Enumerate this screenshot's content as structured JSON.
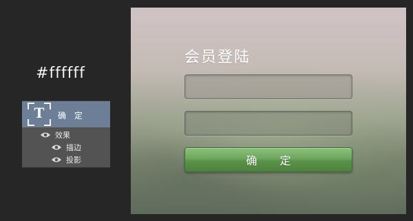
{
  "color_caption": "#ffffff",
  "layers_panel": {
    "text_layer": {
      "thumb_glyph": "T",
      "name": "确 定",
      "icon": "text-layer-icon"
    },
    "effects": {
      "label": "效果",
      "items": [
        "描边",
        "投影"
      ],
      "icon": "eye-icon"
    },
    "selected_color": "#6d7f96"
  },
  "login": {
    "title": "会员登陆",
    "username_value": "",
    "password_value": "",
    "confirm_label": "确 定",
    "button_color": "#6ea75d"
  }
}
